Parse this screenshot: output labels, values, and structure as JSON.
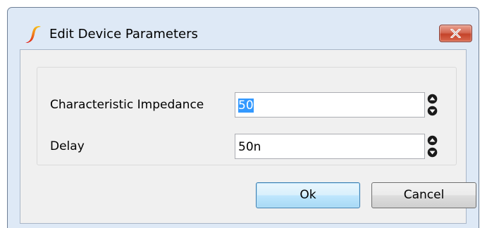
{
  "dialog": {
    "title": "Edit Device Parameters",
    "icon": "simetrix-logo-icon",
    "close_icon": "close-x-icon"
  },
  "params": [
    {
      "label": "Characteristic Impedance",
      "value": "50",
      "selected": true
    },
    {
      "label": "Delay",
      "value": "50n",
      "selected": false
    }
  ],
  "buttons": {
    "ok_label": "Ok",
    "cancel_label": "Cancel"
  },
  "colors": {
    "selection": "#3399ff",
    "close_button": "#c4432a",
    "logo_orange": "#f7a21b",
    "logo_red": "#e0201a",
    "frame": "#dee9f6"
  }
}
